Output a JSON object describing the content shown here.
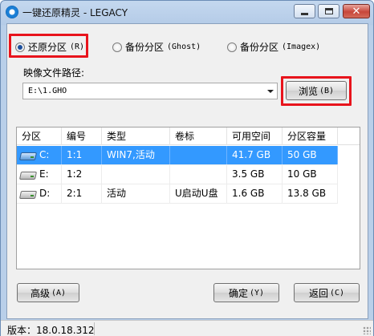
{
  "window": {
    "title": "一键还原精灵 - LEGACY"
  },
  "modes": [
    {
      "label": "还原分区",
      "key": "(R)",
      "selected": true
    },
    {
      "label": "备份分区",
      "key": "(Ghost)",
      "selected": false
    },
    {
      "label": "备份分区",
      "key": "(Imagex)",
      "selected": false
    }
  ],
  "image_path": {
    "label": "映像文件路径:",
    "value": "E:\\1.GHO"
  },
  "browse_button": {
    "label": "浏览",
    "key": "(B)"
  },
  "table": {
    "headers": [
      "分区",
      "编号",
      "类型",
      "卷标",
      "可用空间",
      "分区容量"
    ],
    "rows": [
      {
        "drive": "C:",
        "number": "1:1",
        "type": "WIN7,活动",
        "label": "",
        "free": "41.7 GB",
        "capacity": "50 GB",
        "icon": "system-disk-icon",
        "selected": true
      },
      {
        "drive": "E:",
        "number": "1:2",
        "type": "",
        "label": "",
        "free": "3.5 GB",
        "capacity": "10 GB",
        "icon": "disk-icon",
        "selected": false
      },
      {
        "drive": "D:",
        "number": "2:1",
        "type": "活动",
        "label": "U启动U盘",
        "free": "1.6 GB",
        "capacity": "13.8 GB",
        "icon": "disk-icon",
        "selected": false
      }
    ]
  },
  "buttons": {
    "advanced": {
      "label": "高级",
      "key": "(A)"
    },
    "ok": {
      "label": "确定",
      "key": "(Y)"
    },
    "back": {
      "label": "返回",
      "key": "(C)"
    }
  },
  "status": {
    "version": "版本：18.0.18.312"
  },
  "colors": {
    "highlight": "#e8141c",
    "selection": "#3399ff"
  }
}
